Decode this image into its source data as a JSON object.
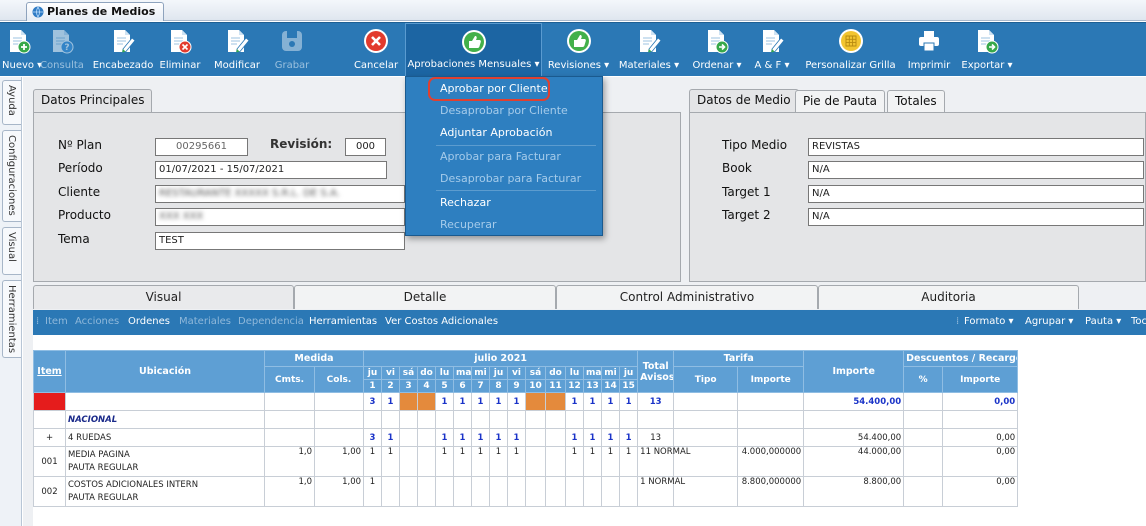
{
  "app_tab": "Planes de Medios",
  "ribbon": [
    {
      "label": "Nuevo ▾",
      "icon": "new-doc-icon",
      "enabled": true
    },
    {
      "label": "Consulta",
      "icon": "query-doc-icon",
      "enabled": false
    },
    {
      "label": "Encabezado",
      "icon": "edit-doc-icon",
      "enabled": true
    },
    {
      "label": "Eliminar",
      "icon": "delete-doc-icon",
      "enabled": true
    },
    {
      "label": "Modificar",
      "icon": "edit-doc-icon",
      "enabled": true
    },
    {
      "label": "Grabar",
      "icon": "save-icon",
      "enabled": false
    },
    {
      "label": "Cancelar",
      "icon": "cancel-icon",
      "enabled": true
    },
    {
      "label": "Aprobaciones Mensuales ▾",
      "icon": "thumbs-up-icon",
      "enabled": true
    },
    {
      "label": "Revisiones ▾",
      "icon": "thumbs-up-icon",
      "enabled": true
    },
    {
      "label": "Materiales ▾",
      "icon": "edit-doc-icon",
      "enabled": true
    },
    {
      "label": "Ordenar ▾",
      "icon": "export-doc-icon",
      "enabled": true
    },
    {
      "label": "A & F ▾",
      "icon": "edit-doc-icon",
      "enabled": true
    },
    {
      "label": "Personalizar Grilla",
      "icon": "grid-icon",
      "enabled": true
    },
    {
      "label": "Imprimir",
      "icon": "printer-icon",
      "enabled": true
    },
    {
      "label": "Exportar ▾",
      "icon": "export-doc-icon",
      "enabled": true
    }
  ],
  "menu": [
    {
      "label": "Aprobar por Cliente",
      "enabled": true
    },
    {
      "label": "Desaprobar por Cliente",
      "enabled": false
    },
    {
      "label": "Adjuntar Aprobación",
      "enabled": true
    },
    {
      "label": "Aprobar para Facturar",
      "enabled": false
    },
    {
      "label": "Desaprobar para Facturar",
      "enabled": false
    },
    {
      "label": "Rechazar",
      "enabled": true
    },
    {
      "label": "Recuperar",
      "enabled": false
    }
  ],
  "side_tabs": [
    "Ayuda",
    "Configuraciones",
    "Visual",
    "Herramientas"
  ],
  "datos_principales": {
    "tab": "Datos Principales",
    "plan_label": "Nº Plan",
    "plan_value": "00295661",
    "revision_label": "Revisión:",
    "revision_value": "000",
    "periodo_label": "Período",
    "periodo_value": "01/07/2021 - 15/07/2021",
    "cliente_label": "Cliente",
    "cliente_value": "RESTAURANTE XXXXX S.R.L. DE S.A.",
    "producto_label": "Producto",
    "producto_value": "XXX XXX",
    "tema_label": "Tema",
    "tema_value": "TEST"
  },
  "datos_medio": {
    "tabs": [
      "Datos de Medio",
      "Pie de Pauta",
      "Totales"
    ],
    "tipo_medio_label": "Tipo Medio",
    "tipo_medio_value": "REVISTAS",
    "book_label": "Book",
    "book_value": "N/A",
    "target1_label": "Target 1",
    "target1_value": "N/A",
    "target2_label": "Target 2",
    "target2_value": "N/A"
  },
  "bottom_tabs": [
    "Visual",
    "Detalle",
    "Control Administrativo",
    "Auditoria"
  ],
  "bottom_toolbar": {
    "left": [
      {
        "label": "Item",
        "enabled": false
      },
      {
        "label": "Acciones",
        "enabled": false
      },
      {
        "label": "Ordenes",
        "enabled": true
      },
      {
        "label": "Materiales",
        "enabled": false
      },
      {
        "label": "Dependencia",
        "enabled": false
      },
      {
        "label": "Herramientas",
        "enabled": true
      },
      {
        "label": "Ver Costos Adicionales",
        "enabled": true
      }
    ],
    "right": [
      "Formato ▾",
      "Agrupar ▾",
      "Pauta ▾",
      "Toc"
    ]
  },
  "grid": {
    "headers": {
      "item": "Item",
      "ubicacion": "Ubicación",
      "medida": "Medida",
      "cmts": "Cmts.",
      "cols": "Cols.",
      "month": "julio 2021",
      "total": "Total",
      "avisos": "Avisos",
      "tarifa": "Tarifa",
      "tipo": "Tipo",
      "importe": "Importe",
      "importe_total": "Importe",
      "descuentos": "Descuentos / Recargos",
      "pct": "%",
      "importe_desc": "Importe"
    },
    "weekdays": [
      "ju",
      "vi",
      "sá",
      "do",
      "lu",
      "ma",
      "mi",
      "ju",
      "vi",
      "sá",
      "do",
      "lu",
      "ma",
      "mi",
      "ju"
    ],
    "days": [
      "1",
      "2",
      "3",
      "4",
      "5",
      "6",
      "7",
      "8",
      "9",
      "10",
      "11",
      "12",
      "13",
      "14",
      "15"
    ],
    "weekend_cols": [
      2,
      3,
      9,
      10
    ],
    "total_row": {
      "marks": [
        "3",
        "1",
        "",
        "",
        "1",
        "1",
        "1",
        "1",
        "1",
        "",
        "",
        "1",
        "1",
        "1",
        "1"
      ],
      "avisos": "13",
      "importe": "54.400,00",
      "desc": "0,00"
    },
    "group_row": {
      "label": "NACIONAL"
    },
    "sub_row": {
      "expander": "+",
      "label": "4 RUEDAS",
      "marks": [
        "3",
        "1",
        "",
        "",
        "1",
        "1",
        "1",
        "1",
        "1",
        "",
        "",
        "1",
        "1",
        "1",
        "1"
      ],
      "avisos": "13",
      "importe": "54.400,00",
      "desc": "0,00"
    },
    "rows": [
      {
        "item": "001",
        "ubicacion": "MEDIA PAGINA",
        "ubicacion2": "PAUTA REGULAR",
        "cmts": "1,0",
        "cols": "1,00",
        "marks": [
          "1",
          "1",
          "",
          "",
          "1",
          "1",
          "1",
          "1",
          "1",
          "",
          "",
          "1",
          "1",
          "1",
          "1"
        ],
        "avisos": "11",
        "tipo": "NORMAL",
        "tarifa": "4.000,000000",
        "importe": "44.000,00",
        "desc": "0,00"
      },
      {
        "item": "002",
        "ubicacion": "COSTOS ADICIONALES INTERN",
        "ubicacion2": "PAUTA REGULAR",
        "cmts": "1,0",
        "cols": "1,00",
        "marks": [
          "1",
          "",
          "",
          "",
          "",
          "",
          "",
          "",
          "",
          "",
          "",
          "",
          "",
          "",
          ""
        ],
        "avisos": "1",
        "tipo": "NORMAL",
        "tarifa": "8.800,000000",
        "importe": "8.800,00",
        "desc": "0,00"
      }
    ]
  }
}
